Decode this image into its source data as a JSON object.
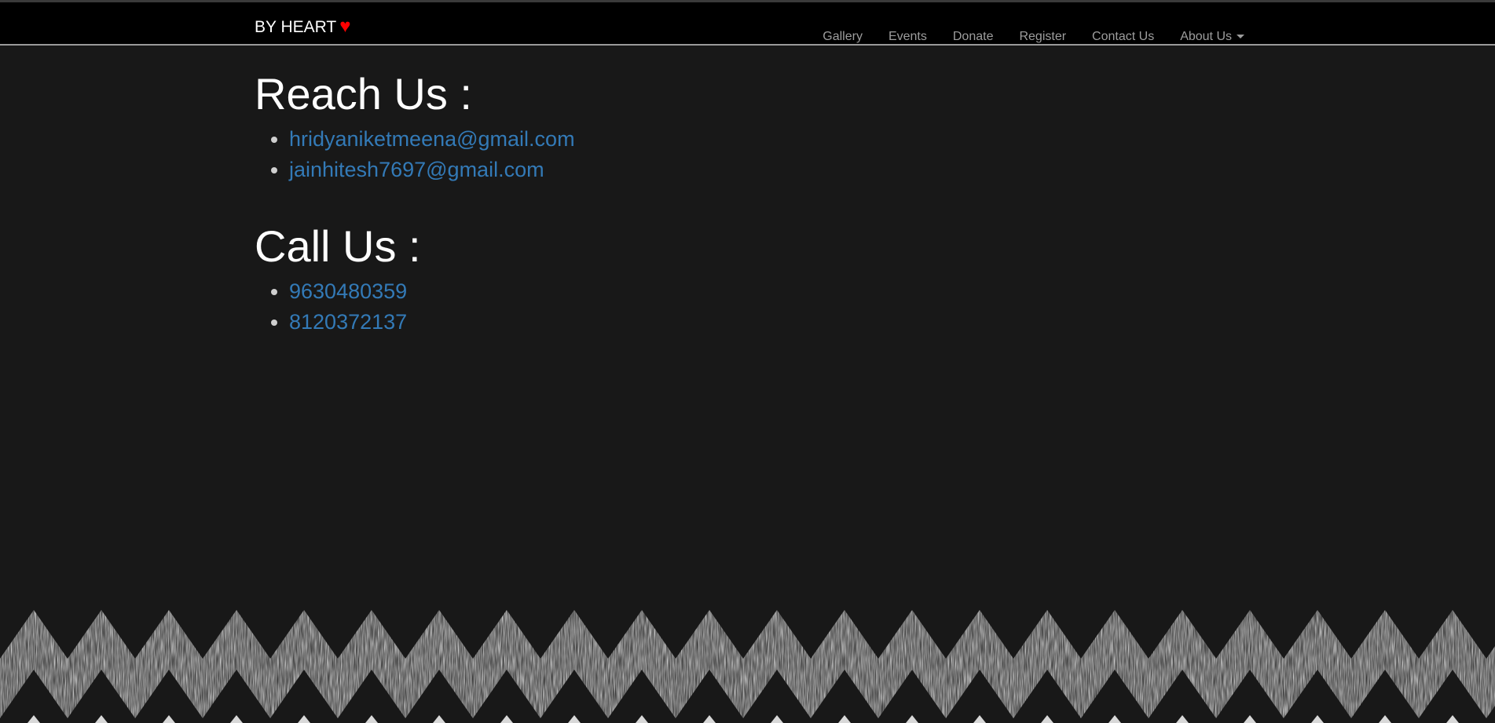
{
  "navbar": {
    "brand": "BY HEART",
    "brand_icon": "heart-icon",
    "links": [
      "Gallery",
      "Events",
      "Donate",
      "Register",
      "Contact Us"
    ],
    "dropdown": {
      "label": "About Us",
      "icon": "caret-down-icon"
    }
  },
  "reach": {
    "heading": "Reach Us :",
    "emails": [
      "hridyaniketmeena@gmail.com",
      "jainhitesh7697@gmail.com"
    ]
  },
  "call": {
    "heading": "Call Us :",
    "phones": [
      "9630480359",
      "8120372137"
    ]
  },
  "colors": {
    "background": "#181818",
    "navbar": "#000000",
    "link": "#337ab7",
    "heart": "#ff0000",
    "nav_text": "#9d9d9d"
  }
}
